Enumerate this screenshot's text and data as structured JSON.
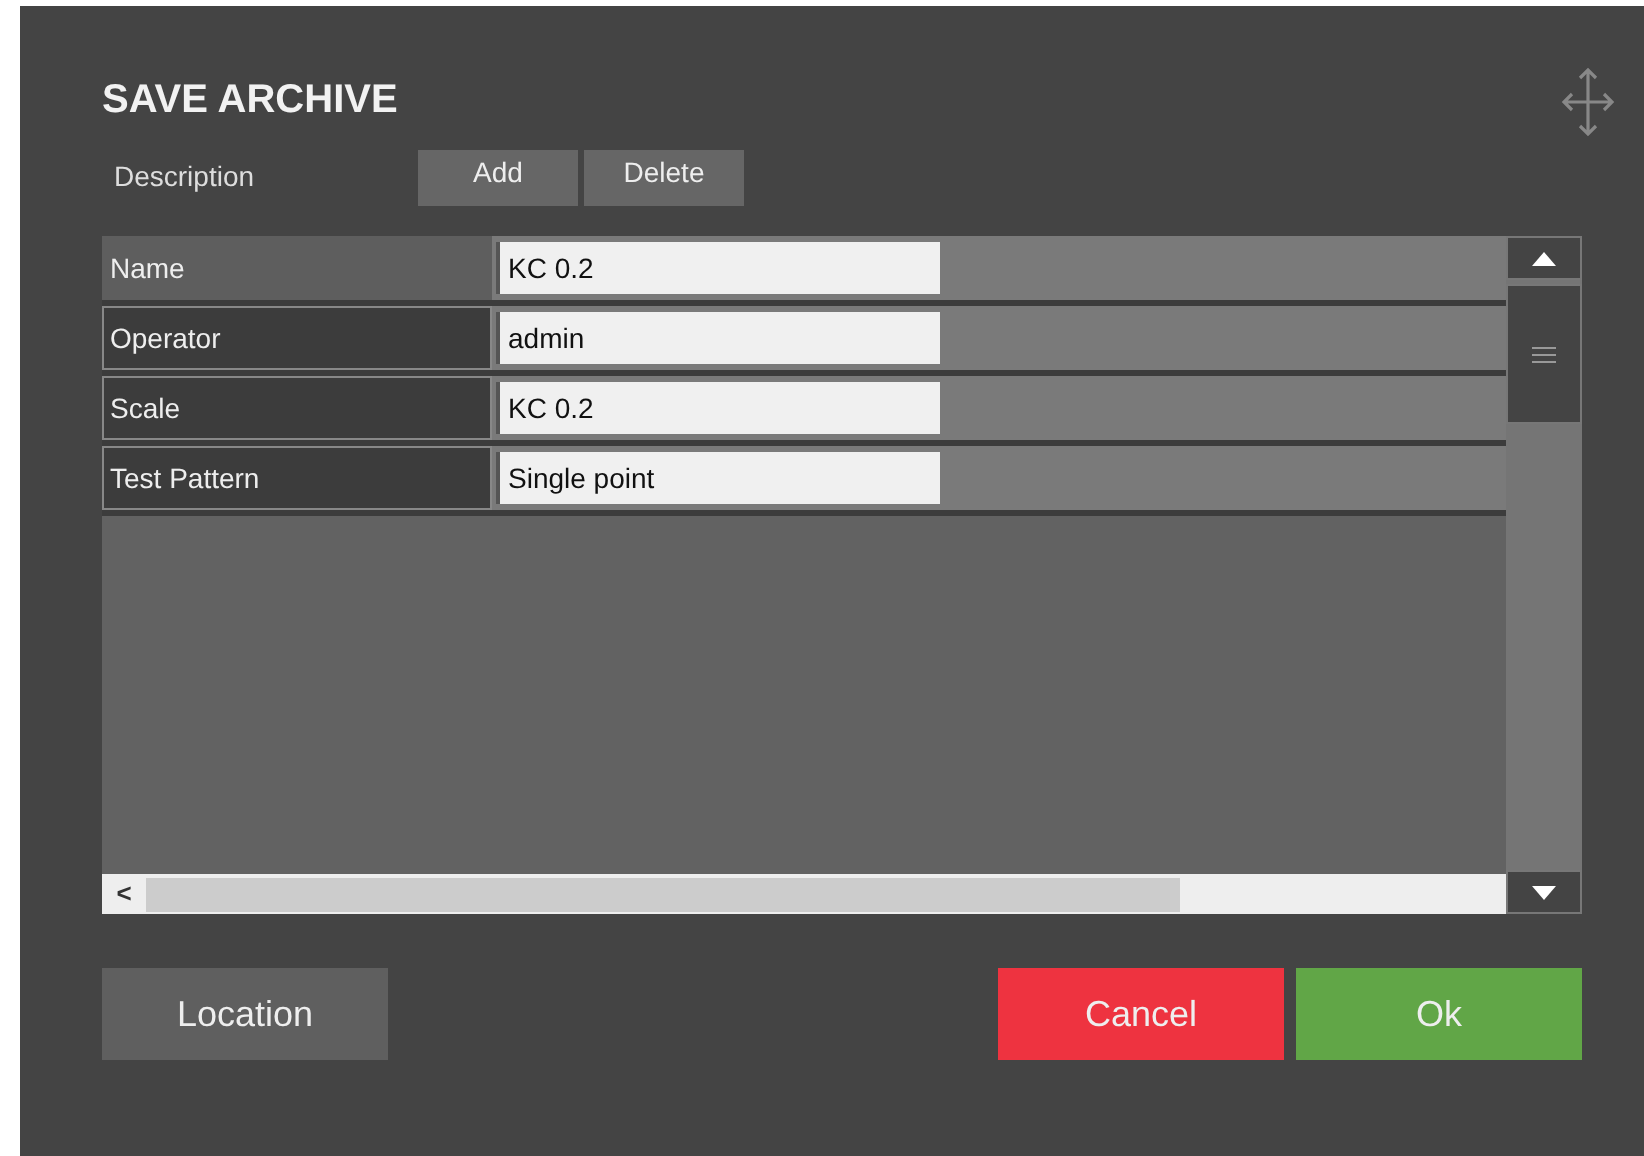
{
  "dialog": {
    "title": "SAVE ARCHIVE"
  },
  "description": {
    "label": "Description",
    "buttons": [
      "Add",
      "Delete"
    ]
  },
  "fields": [
    {
      "label": "Name",
      "value": "KC 0.2",
      "selected": true
    },
    {
      "label": "Operator",
      "value": "admin",
      "selected": false
    },
    {
      "label": "Scale",
      "value": "KC 0.2",
      "selected": false
    },
    {
      "label": "Test Pattern",
      "value": "Single point",
      "selected": false
    }
  ],
  "scrollbar": {
    "left_arrow": "<"
  },
  "buttons": [
    {
      "label": "Location",
      "kind": "neutral"
    },
    {
      "label": "Cancel",
      "kind": "danger"
    },
    {
      "label": "Ok",
      "kind": "confirm"
    }
  ]
}
